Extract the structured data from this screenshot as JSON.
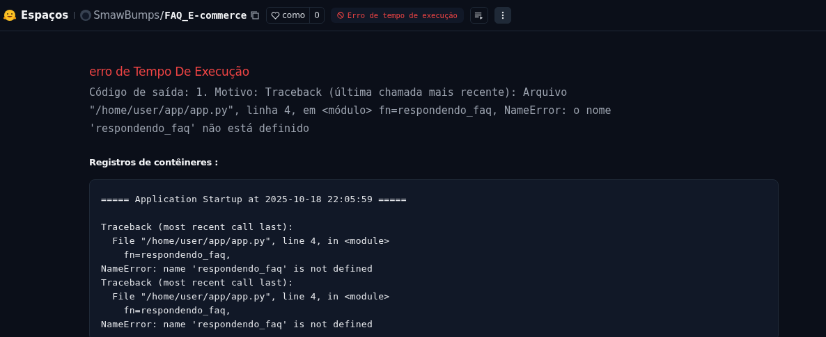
{
  "header": {
    "brand": "Espaços",
    "owner": "SmawBumps",
    "separator": "/",
    "repo": "FAQ_E-commerce",
    "like": {
      "label": "como",
      "count": "0"
    },
    "status": {
      "kind": "error",
      "label": "Erro de tempo de execução"
    }
  },
  "error": {
    "title": "erro de Tempo De Execução",
    "message": "Código de saída: 1. Motivo: Traceback (última chamada mais recente): Arquivo \"/home/user/app/app.py\", linha 4, em <módulo> fn=respondendo_faq, NameError: o nome 'respondendo_faq' não está definido"
  },
  "logs": {
    "heading": "Registros de contêineres :",
    "blocks": [
      [
        "===== Application Startup at 2025-10-18 22:05:59 ====="
      ],
      [
        "Traceback (most recent call last):",
        "  File \"/home/user/app/app.py\", line 4, in <module>",
        "    fn=respondendo_faq,",
        "NameError: name 'respondendo_faq' is not defined",
        "Traceback (most recent call last):",
        "  File \"/home/user/app/app.py\", line 4, in <module>",
        "    fn=respondendo_faq,",
        "NameError: name 'respondendo_faq' is not defined"
      ]
    ]
  }
}
